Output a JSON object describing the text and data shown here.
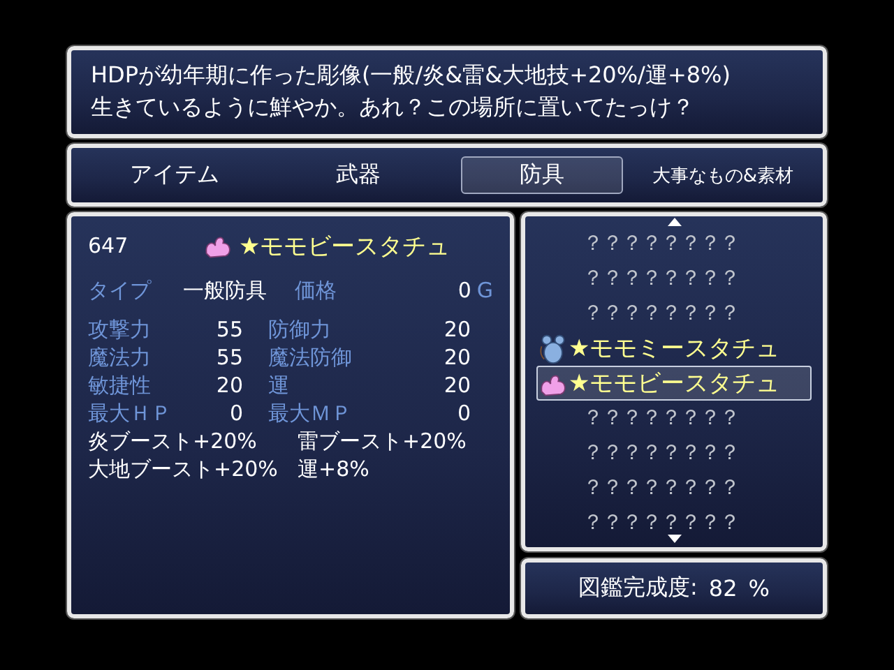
{
  "help": {
    "lines": [
      "HDPが幼年期に作った彫像(一般/炎&雷&大地技+20%/運+8%)",
      "生きているように鮮やか。あれ？この場所に置いてたっけ？"
    ]
  },
  "tabs": [
    {
      "label": "アイテム",
      "selected": false
    },
    {
      "label": "武器",
      "selected": false
    },
    {
      "label": "防具",
      "selected": true
    },
    {
      "label": "大事なもの&素材",
      "selected": false
    }
  ],
  "detail": {
    "number": "647",
    "kind": "blob",
    "name": "★モモビースタチュ",
    "type_label": "タイプ",
    "type_value": "一般防具",
    "price_label": "価格",
    "price_value": "0",
    "currency": "G",
    "stats": [
      {
        "label": "攻撃力",
        "value": "55"
      },
      {
        "label": "防御力",
        "value": "20"
      },
      {
        "label": "魔法力",
        "value": "55"
      },
      {
        "label": "魔法防御",
        "value": "20"
      },
      {
        "label": "敏捷性",
        "value": "20"
      },
      {
        "label": "運",
        "value": "20"
      },
      {
        "label": "最大ＨＰ",
        "value": "0"
      },
      {
        "label": "最大ＭＰ",
        "value": "0"
      }
    ],
    "effects": [
      "炎ブースト+20%",
      "雷ブースト+20%",
      "大地ブースト+20%",
      "運+8%"
    ]
  },
  "list": {
    "items": [
      {
        "kind": "unknown",
        "name": "？？？？？？？？",
        "selected": false
      },
      {
        "kind": "unknown",
        "name": "？？？？？？？？",
        "selected": false
      },
      {
        "kind": "unknown",
        "name": "？？？？？？？？",
        "selected": false
      },
      {
        "kind": "mouse",
        "name": "★モモミースタチュ",
        "selected": false
      },
      {
        "kind": "blob",
        "name": "★モモビースタチュ",
        "selected": true
      },
      {
        "kind": "unknown",
        "name": "？？？？？？？？",
        "selected": false
      },
      {
        "kind": "unknown",
        "name": "？？？？？？？？",
        "selected": false
      },
      {
        "kind": "unknown",
        "name": "？？？？？？？？",
        "selected": false
      },
      {
        "kind": "unknown",
        "name": "？？？？？？？？",
        "selected": false
      }
    ]
  },
  "completion": {
    "label": "図鑑完成度:",
    "value": "82",
    "unit": "%"
  }
}
